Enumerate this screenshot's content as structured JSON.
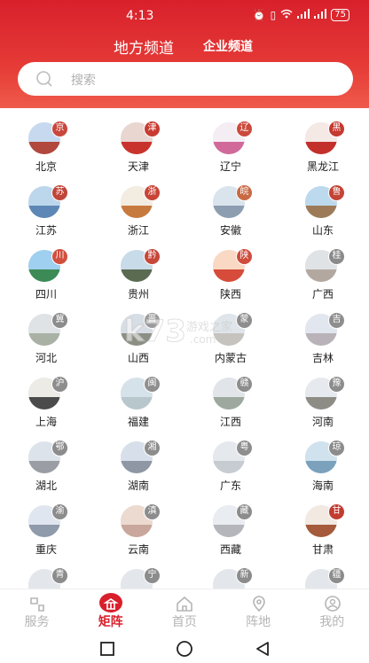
{
  "status": {
    "time": "4:13",
    "battery": "75"
  },
  "tabs": {
    "main": "地方频道",
    "sub": "企业频道"
  },
  "search": {
    "placeholder": "搜索"
  },
  "regions": [
    {
      "name": "北京",
      "badge": "京",
      "badge_color": "#c9473d"
    },
    {
      "name": "天津",
      "badge": "津",
      "badge_color": "#c83b32"
    },
    {
      "name": "辽宁",
      "badge": "辽",
      "badge_color": "#cc4a3c"
    },
    {
      "name": "黑龙江",
      "badge": "黑",
      "badge_color": "#c43a30"
    },
    {
      "name": "江苏",
      "badge": "苏",
      "badge_color": "#c0463a"
    },
    {
      "name": "浙江",
      "badge": "浙",
      "badge_color": "#c84437"
    },
    {
      "name": "安徽",
      "badge": "皖",
      "badge_color": "#c96a45"
    },
    {
      "name": "山东",
      "badge": "鲁",
      "badge_color": "#c34535"
    },
    {
      "name": "四川",
      "badge": "川",
      "badge_color": "#d2503f"
    },
    {
      "name": "贵州",
      "badge": "黔",
      "badge_color": "#c7473a"
    },
    {
      "name": "陕西",
      "badge": "陕",
      "badge_color": "#cf4d3d"
    },
    {
      "name": "广西",
      "badge": "桂",
      "badge_color": "#8a8a8a"
    },
    {
      "name": "河北",
      "badge": "冀",
      "badge_color": "#8c8c8c"
    },
    {
      "name": "山西",
      "badge": "晋",
      "badge_color": "#9a9a9a"
    },
    {
      "name": "内蒙古",
      "badge": "蒙",
      "badge_color": "#8e8e8e"
    },
    {
      "name": "吉林",
      "badge": "吉",
      "badge_color": "#8e8e8e"
    },
    {
      "name": "上海",
      "badge": "沪",
      "badge_color": "#8d8d8d"
    },
    {
      "name": "福建",
      "badge": "闽",
      "badge_color": "#8f8f8f"
    },
    {
      "name": "江西",
      "badge": "赣",
      "badge_color": "#8d8d8d"
    },
    {
      "name": "河南",
      "badge": "豫",
      "badge_color": "#8d8d8d"
    },
    {
      "name": "湖北",
      "badge": "鄂",
      "badge_color": "#8c8c8c"
    },
    {
      "name": "湖南",
      "badge": "湘",
      "badge_color": "#8c8c8c"
    },
    {
      "name": "广东",
      "badge": "粤",
      "badge_color": "#8e8e8e"
    },
    {
      "name": "海南",
      "badge": "琼",
      "badge_color": "#8c8c8c"
    },
    {
      "name": "重庆",
      "badge": "渝",
      "badge_color": "#8c8c8c"
    },
    {
      "name": "云南",
      "badge": "滇",
      "badge_color": "#8c8c8c"
    },
    {
      "name": "西藏",
      "badge": "藏",
      "badge_color": "#8c8c8c"
    },
    {
      "name": "甘肃",
      "badge": "甘",
      "badge_color": "#c23b31"
    },
    {
      "name": "",
      "badge": "青",
      "badge_color": "#8c8c8c"
    },
    {
      "name": "",
      "badge": "宁",
      "badge_color": "#8c8c8c"
    },
    {
      "name": "",
      "badge": "新",
      "badge_color": "#8c8c8c"
    },
    {
      "name": "",
      "badge": "疆",
      "badge_color": "#8c8c8c"
    }
  ],
  "watermark": {
    "big": "k73",
    "cn": "游戏之家",
    "url": ".com"
  },
  "nav": [
    {
      "label": "服务",
      "icon": "service-icon",
      "active": false
    },
    {
      "label": "矩阵",
      "icon": "matrix-icon",
      "active": true
    },
    {
      "label": "首页",
      "icon": "home-icon",
      "active": false
    },
    {
      "label": "阵地",
      "icon": "location-icon",
      "active": false
    },
    {
      "label": "我的",
      "icon": "profile-icon",
      "active": false
    }
  ],
  "colors": {
    "brand": "#d8202c",
    "nav_inactive": "#b5b5b5"
  }
}
